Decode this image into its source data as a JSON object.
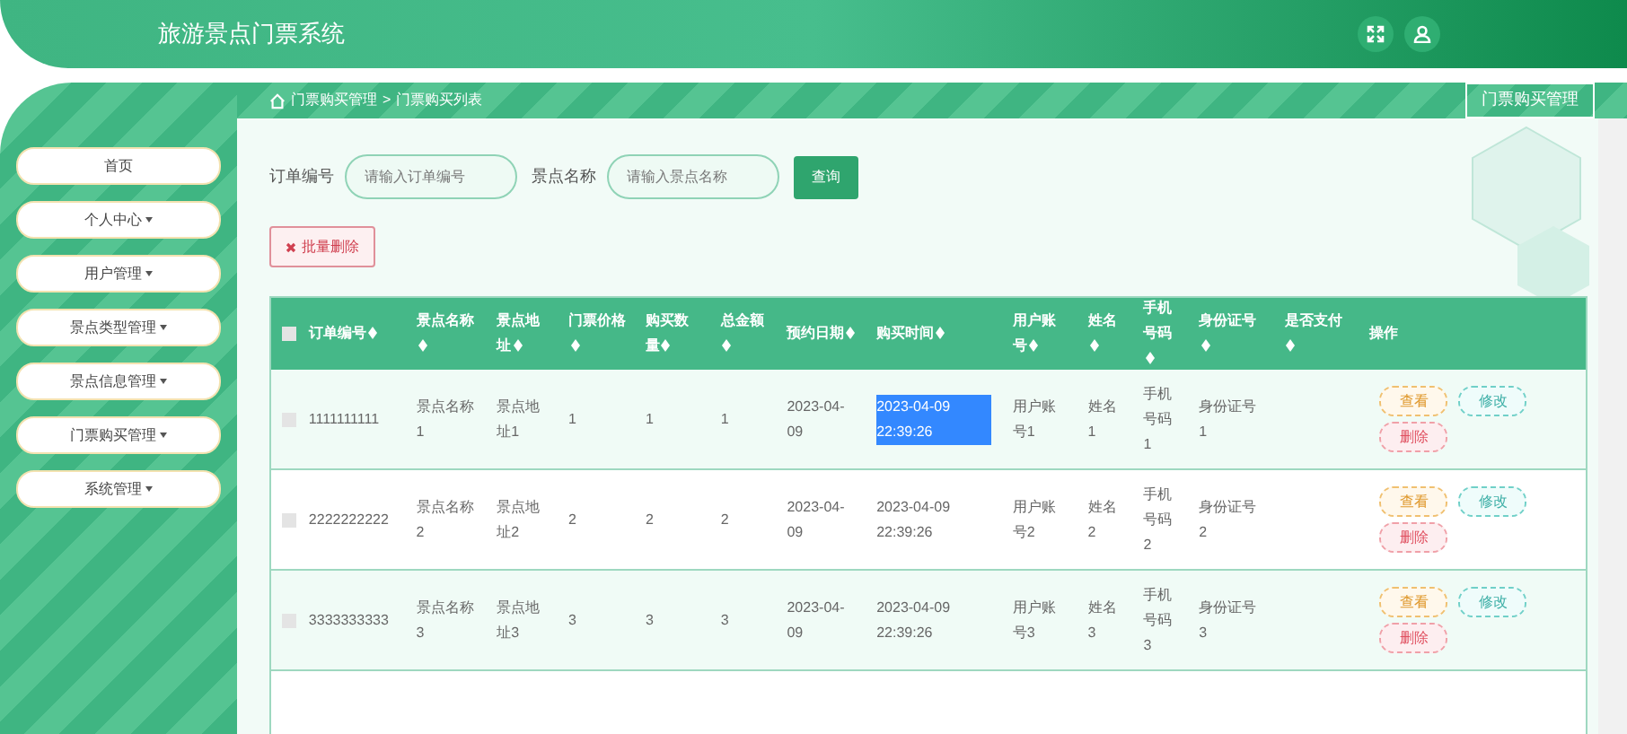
{
  "header": {
    "title": "旅游景点门票系统"
  },
  "sidebar": {
    "items": [
      {
        "label": "首页",
        "has_caret": false
      },
      {
        "label": "个人中心",
        "has_caret": true
      },
      {
        "label": "用户管理",
        "has_caret": true
      },
      {
        "label": "景点类型管理",
        "has_caret": true
      },
      {
        "label": "景点信息管理",
        "has_caret": true
      },
      {
        "label": "门票购买管理",
        "has_caret": true
      },
      {
        "label": "系统管理",
        "has_caret": true
      }
    ]
  },
  "breadcrumb": [
    "门票购买管理",
    "门票购买列表"
  ],
  "breadcrumb_separator": ">",
  "page_button": "门票购买管理",
  "search": {
    "fields": [
      {
        "label": "订单编号",
        "placeholder": "请输入订单编号"
      },
      {
        "label": "景点名称",
        "placeholder": "请输入景点名称"
      }
    ],
    "button": "查询"
  },
  "batch_delete": "批量删除",
  "table": {
    "select_all_checked": false,
    "columns": [
      {
        "label": "订单编号",
        "sortable": true
      },
      {
        "label": "景点名称",
        "sortable": true
      },
      {
        "label": "景点地址",
        "sortable": true
      },
      {
        "label": "门票价格",
        "sortable": true
      },
      {
        "label": "购买数量",
        "sortable": true
      },
      {
        "label": "总金额",
        "sortable": true
      },
      {
        "label": "预约日期",
        "sortable": true
      },
      {
        "label": "购买时间",
        "sortable": true
      },
      {
        "label": "用户账号",
        "sortable": true
      },
      {
        "label": "姓名",
        "sortable": true
      },
      {
        "label": "手机号码",
        "sortable": true
      },
      {
        "label": "身份证号",
        "sortable": true
      },
      {
        "label": "是否支付",
        "sortable": true
      },
      {
        "label": "操作",
        "sortable": false
      }
    ],
    "rows": [
      {
        "checked": false,
        "time_highlighted": true,
        "cells": [
          "1111111111",
          "景点名称1",
          "景点地址1",
          "1",
          "1",
          "1",
          "2023-04-09",
          "2023-04-09 22:39:26",
          "用户账号1",
          "姓名1",
          "手机号码1",
          "身份证号1",
          ""
        ],
        "actions": [
          "查看",
          "修改",
          "删除"
        ]
      },
      {
        "checked": false,
        "time_highlighted": false,
        "cells": [
          "2222222222",
          "景点名称2",
          "景点地址2",
          "2",
          "2",
          "2",
          "2023-04-09",
          "2023-04-09 22:39:26",
          "用户账号2",
          "姓名2",
          "手机号码2",
          "身份证号2",
          ""
        ],
        "actions": [
          "查看",
          "修改",
          "删除"
        ]
      },
      {
        "checked": false,
        "time_highlighted": false,
        "cells": [
          "3333333333",
          "景点名称3",
          "景点地址3",
          "3",
          "3",
          "3",
          "2023-04-09",
          "2023-04-09 22:39:26",
          "用户账号3",
          "姓名3",
          "手机号码3",
          "身份证号3",
          ""
        ],
        "actions": [
          "查看",
          "修改",
          "删除"
        ]
      }
    ]
  }
}
